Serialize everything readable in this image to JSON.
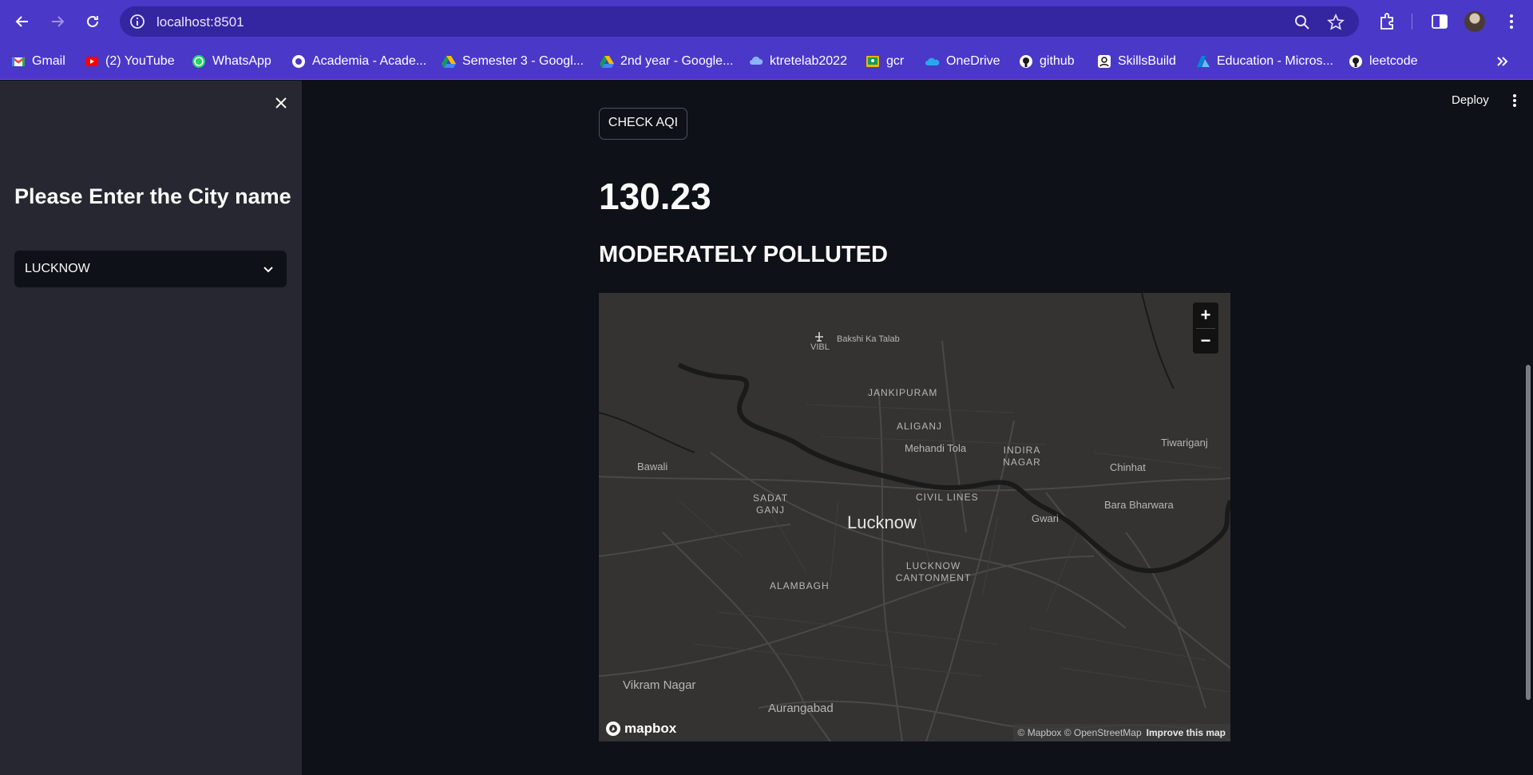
{
  "browser": {
    "url": "localhost:8501",
    "bookmarks": [
      {
        "label": "Gmail",
        "icon": "gmail-icon"
      },
      {
        "label": "(2) YouTube",
        "icon": "youtube-icon"
      },
      {
        "label": "WhatsApp",
        "icon": "whatsapp-icon"
      },
      {
        "label": "Academia - Acade...",
        "icon": "academia-icon"
      },
      {
        "label": "Semester 3 - Googl...",
        "icon": "google-drive-icon"
      },
      {
        "label": "2nd year - Google...",
        "icon": "google-drive-icon"
      },
      {
        "label": "ktretelab2022",
        "icon": "cloud-icon"
      },
      {
        "label": "gcr",
        "icon": "classroom-icon"
      },
      {
        "label": "OneDrive",
        "icon": "onedrive-icon"
      },
      {
        "label": "github",
        "icon": "github-icon"
      },
      {
        "label": "SkillsBuild",
        "icon": "skillsbuild-icon"
      },
      {
        "label": "Education - Micros...",
        "icon": "azure-icon"
      },
      {
        "label": "leetcode",
        "icon": "github-icon"
      }
    ],
    "colors": {
      "chrome": "#4a38c8",
      "address_bar": "#3426a0"
    }
  },
  "sidebar": {
    "heading": "Please Enter the City name",
    "city_select": {
      "value": "LUCKNOW"
    }
  },
  "main": {
    "deploy_label": "Deploy",
    "check_aqi_label": "CHECK AQI",
    "aqi_value": "130.23",
    "aqi_status": "MODERATELY POLLUTED"
  },
  "map": {
    "labels": {
      "bakshi_ka_talab": "Bakshi Ka Talab",
      "vibl": "VIBL",
      "jankipuram": "JANKIPURAM",
      "aliganj": "ALIGANJ",
      "mehandi_tola": "Mehandi Tola",
      "indira_nagar": "INDIRA NAGAR",
      "tiwariganj": "Tiwariganj",
      "chinhat": "Chinhat",
      "bawali": "Bawali",
      "sadat_ganj": "SADAT GANJ",
      "civil_lines": "CIVIL LINES",
      "lucknow": "Lucknow",
      "gwari": "Gwari",
      "bara_bharwara": "Bara Bharwara",
      "lucknow_cantonment": "LUCKNOW CANTONMENT",
      "alambagh": "ALAMBAGH",
      "vikram_nagar": "Vikram Nagar",
      "aurangabad": "Aurangabad"
    },
    "zoom_in": "+",
    "zoom_out": "−",
    "logo_text": "mapbox",
    "attribution": "© Mapbox © OpenStreetMap",
    "improve_link": "Improve this map",
    "colors": {
      "land": "#343332",
      "water": "#1a1a1a",
      "road": "#4a4948"
    }
  }
}
